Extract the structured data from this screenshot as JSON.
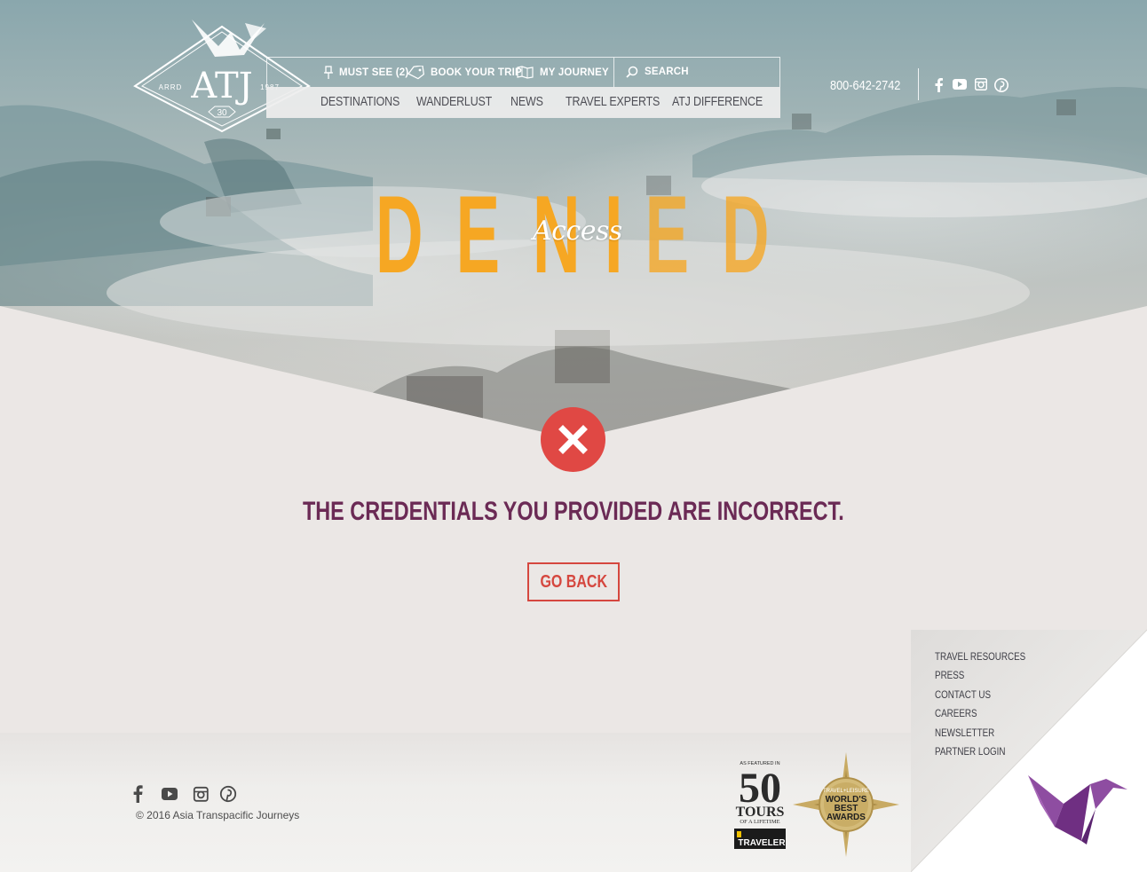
{
  "logo": {
    "name": "ATJ",
    "left_text": "ARRD",
    "right_text": "1987",
    "badge_text": "30"
  },
  "nav": {
    "utility": [
      {
        "label": "MUST SEE (2)",
        "icon": "pin-icon"
      },
      {
        "label": "BOOK YOUR TRIP",
        "icon": "tag-icon"
      },
      {
        "label": "MY JOURNEY",
        "icon": "map-icon"
      }
    ],
    "search_label": "SEARCH",
    "main": [
      "DESTINATIONS",
      "WANDERLUST",
      "NEWS",
      "TRAVEL EXPERTS",
      "ATJ DIFFERENCE"
    ]
  },
  "header": {
    "phone": "800-642-2742",
    "social": [
      "facebook-icon",
      "youtube-icon",
      "instagram-icon",
      "pinterest-icon"
    ]
  },
  "hero": {
    "headline": "DENIED",
    "overlay": "Access"
  },
  "error": {
    "icon": "close-icon",
    "message": "THE CREDENTIALS YOU PROVIDED ARE INCORRECT.",
    "button": "GO BACK"
  },
  "footer": {
    "copyright": "© 2016 Asia Transpacific Journeys",
    "links": [
      "TRAVEL RESOURCES",
      "PRESS",
      "CONTACT US",
      "CAREERS",
      "NEWSLETTER",
      "PARTNER LOGIN"
    ],
    "badge_50": {
      "top": "AS FEATURED IN",
      "number": "50",
      "line1": "TOURS",
      "line2": "OF A LIFETIME",
      "brand": "TRAVELER"
    },
    "badge_award": {
      "top": "TRAVEL+LEISURE",
      "line1": "WORLD'S",
      "line2": "BEST",
      "line3": "AWARDS"
    }
  },
  "colors": {
    "accent_orange": "#f6a723",
    "message_purple": "#6b2a55",
    "error_red": "#e04844",
    "button_red": "#d5473f",
    "crane_purple": "#7b3c8c"
  }
}
